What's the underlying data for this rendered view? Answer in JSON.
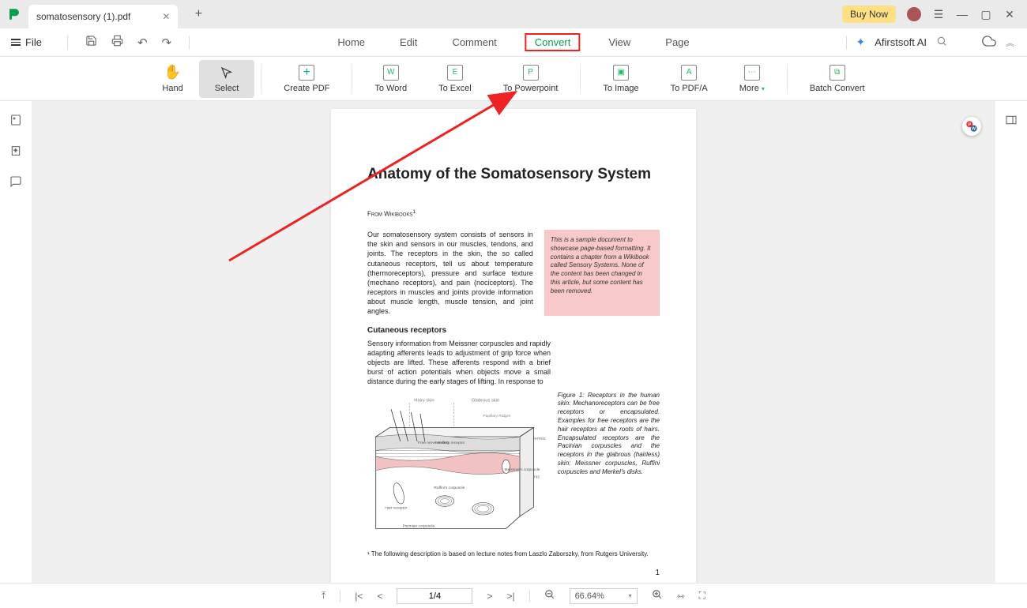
{
  "titlebar": {
    "tab_title": "somatosensory (1).pdf",
    "buynow": "Buy Now"
  },
  "menubar": {
    "file": "File",
    "main": {
      "home": "Home",
      "edit": "Edit",
      "comment": "Comment",
      "convert": "Convert",
      "view": "View",
      "page": "Page"
    },
    "ai": "Afirstsoft AI"
  },
  "ribbon": {
    "hand": "Hand",
    "select": "Select",
    "createpdf": "Create PDF",
    "toword": "To Word",
    "toexcel": "To Excel",
    "topowerpoint": "To Powerpoint",
    "toimage": "To Image",
    "topdfa": "To PDF/A",
    "more": "More",
    "batch": "Batch Convert"
  },
  "doc": {
    "title": "Anatomy of the Somatosensory System",
    "source": "From Wikibooks",
    "intro": "Our somatosensory system consists of sensors in the skin and sensors in our muscles, tendons, and joints. The receptors in the skin, the so called cutaneous receptors, tell us about temperature (thermoreceptors), pressure and surface texture (mechano receptors), and pain (nociceptors). The receptors in muscles and joints provide information about muscle length, muscle tension, and joint angles.",
    "box": "This is a sample document to showcase page-based formatting. It contains a chapter from a Wikibook called Sensory Systems. None of the content has been changed in this article, but some content has been removed.",
    "h_cutaneous": "Cutaneous receptors",
    "cutaneous": "Sensory information from Meissner corpuscles and rapidly adapting afferents leads to adjustment of grip force when objects are lifted. These afferents respond with a brief burst of action potentials when objects move a small distance during the early stages of lifting. In response to",
    "caption": "Figure 1:  Receptors in the human skin: Mechanoreceptors can be free receptors or encapsulated. Examples for free receptors are the hair receptors at the roots of hairs. Encapsulated receptors are the Pacinian corpuscles and the receptors in the glabrous (hairless) skin: Meissner corpuscles, Ruffini corpuscles and Merkel's disks.",
    "footnote": "¹ The following description is based on lecture notes from Laszlo Zaborszky, from Rutgers University.",
    "pagenum": "1",
    "fig_labels": {
      "hairy": "Hairy skin",
      "glabrous": "Glabrous skin",
      "papillary": "Papillary Ridges",
      "epidermis": "Epidermis",
      "dermis": "Dermis",
      "freenerve": "Free nerve ending",
      "merkel": "Merkel's receptor",
      "meissner": "Meissner's corpuscle",
      "ruffini": "Ruffini's corpuscle",
      "pacinian": "Pacinian corpuscle",
      "hair": "Hair receptor"
    }
  },
  "footer": {
    "page": "1/4",
    "zoom": "66.64%"
  }
}
